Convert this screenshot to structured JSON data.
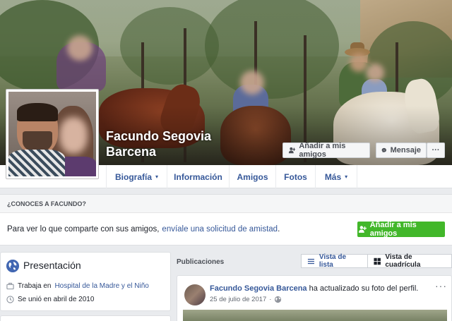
{
  "profile": {
    "name": "Facundo Segovia Barcena"
  },
  "cover_actions": {
    "add_friend_label": "Añadir a mis amigos",
    "message_label": "Mensaje",
    "more_label": "···"
  },
  "nav": {
    "items": [
      {
        "label": "Biografía",
        "has_caret": true
      },
      {
        "label": "Información"
      },
      {
        "label": "Amigos"
      },
      {
        "label": "Fotos"
      },
      {
        "label": "Más",
        "has_caret": true
      }
    ],
    "caret": "▾"
  },
  "know_box": {
    "header": "¿CONOCES A FACUNDO?",
    "text": "Para ver lo que comparte con sus amigos,",
    "link": "envíale una solicitud de amistad",
    "suffix": ".",
    "button_label": "Añadir a mis amigos"
  },
  "presentation": {
    "title": "Presentación",
    "work_prefix": "Trabaja en",
    "work_place": "Hospital de la Madre y el Niño",
    "joined": "Se unió en abril de 2010"
  },
  "feed": {
    "label": "Publicaciones",
    "list_view": "Vista de lista",
    "grid_view": "Vista de cuadrícula"
  },
  "post": {
    "author": "Facundo Segovia Barcena",
    "action": "ha actualizado su foto del perfil.",
    "date": "25 de julio de 2017",
    "dot": "·",
    "more": "···"
  },
  "colors": {
    "link_blue": "#365899",
    "green_button": "#42b72a",
    "background": "#e9ebee"
  },
  "icons": [
    "add-friend-icon",
    "messenger-icon",
    "globe-icon",
    "briefcase-icon",
    "clock-icon",
    "list-icon",
    "grid-icon",
    "public-globe-icon"
  ]
}
